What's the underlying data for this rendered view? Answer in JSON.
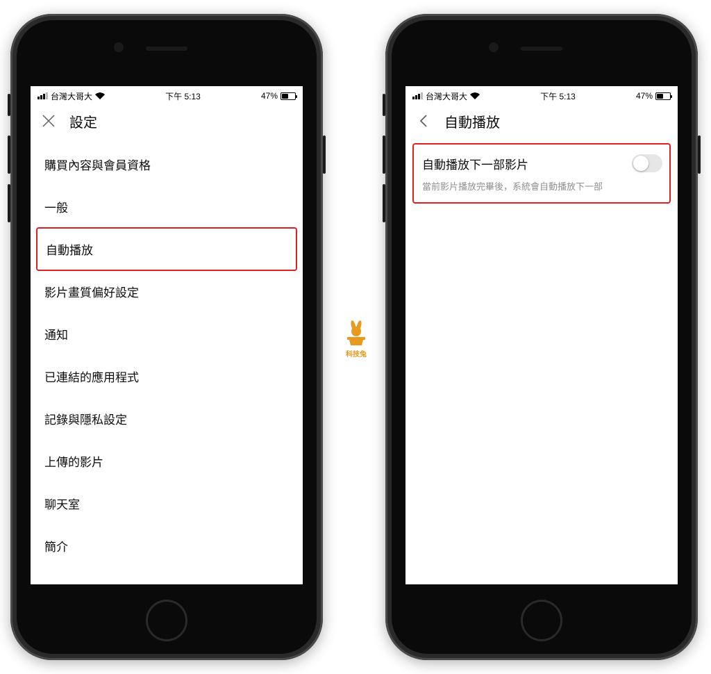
{
  "status_bar": {
    "carrier": "台灣大哥大",
    "time": "下午 5:13",
    "battery_pct": "47%"
  },
  "left_screen": {
    "title": "設定",
    "items": {
      "0": "購買內容與會員資格",
      "1": "一般",
      "2": "自動播放",
      "3": "影片畫質偏好設定",
      "4": "通知",
      "5": "已連結的應用程式",
      "6": "記錄與隱私設定",
      "7": "上傳的影片",
      "8": "聊天室",
      "9": "簡介"
    },
    "highlighted_index": 2
  },
  "right_screen": {
    "title": "自動播放",
    "option_title": "自動播放下一部影片",
    "option_desc": "當前影片播放完畢後，系統會自動播放下一部",
    "toggle_on": false
  },
  "watermark": {
    "label": "科技兔"
  }
}
